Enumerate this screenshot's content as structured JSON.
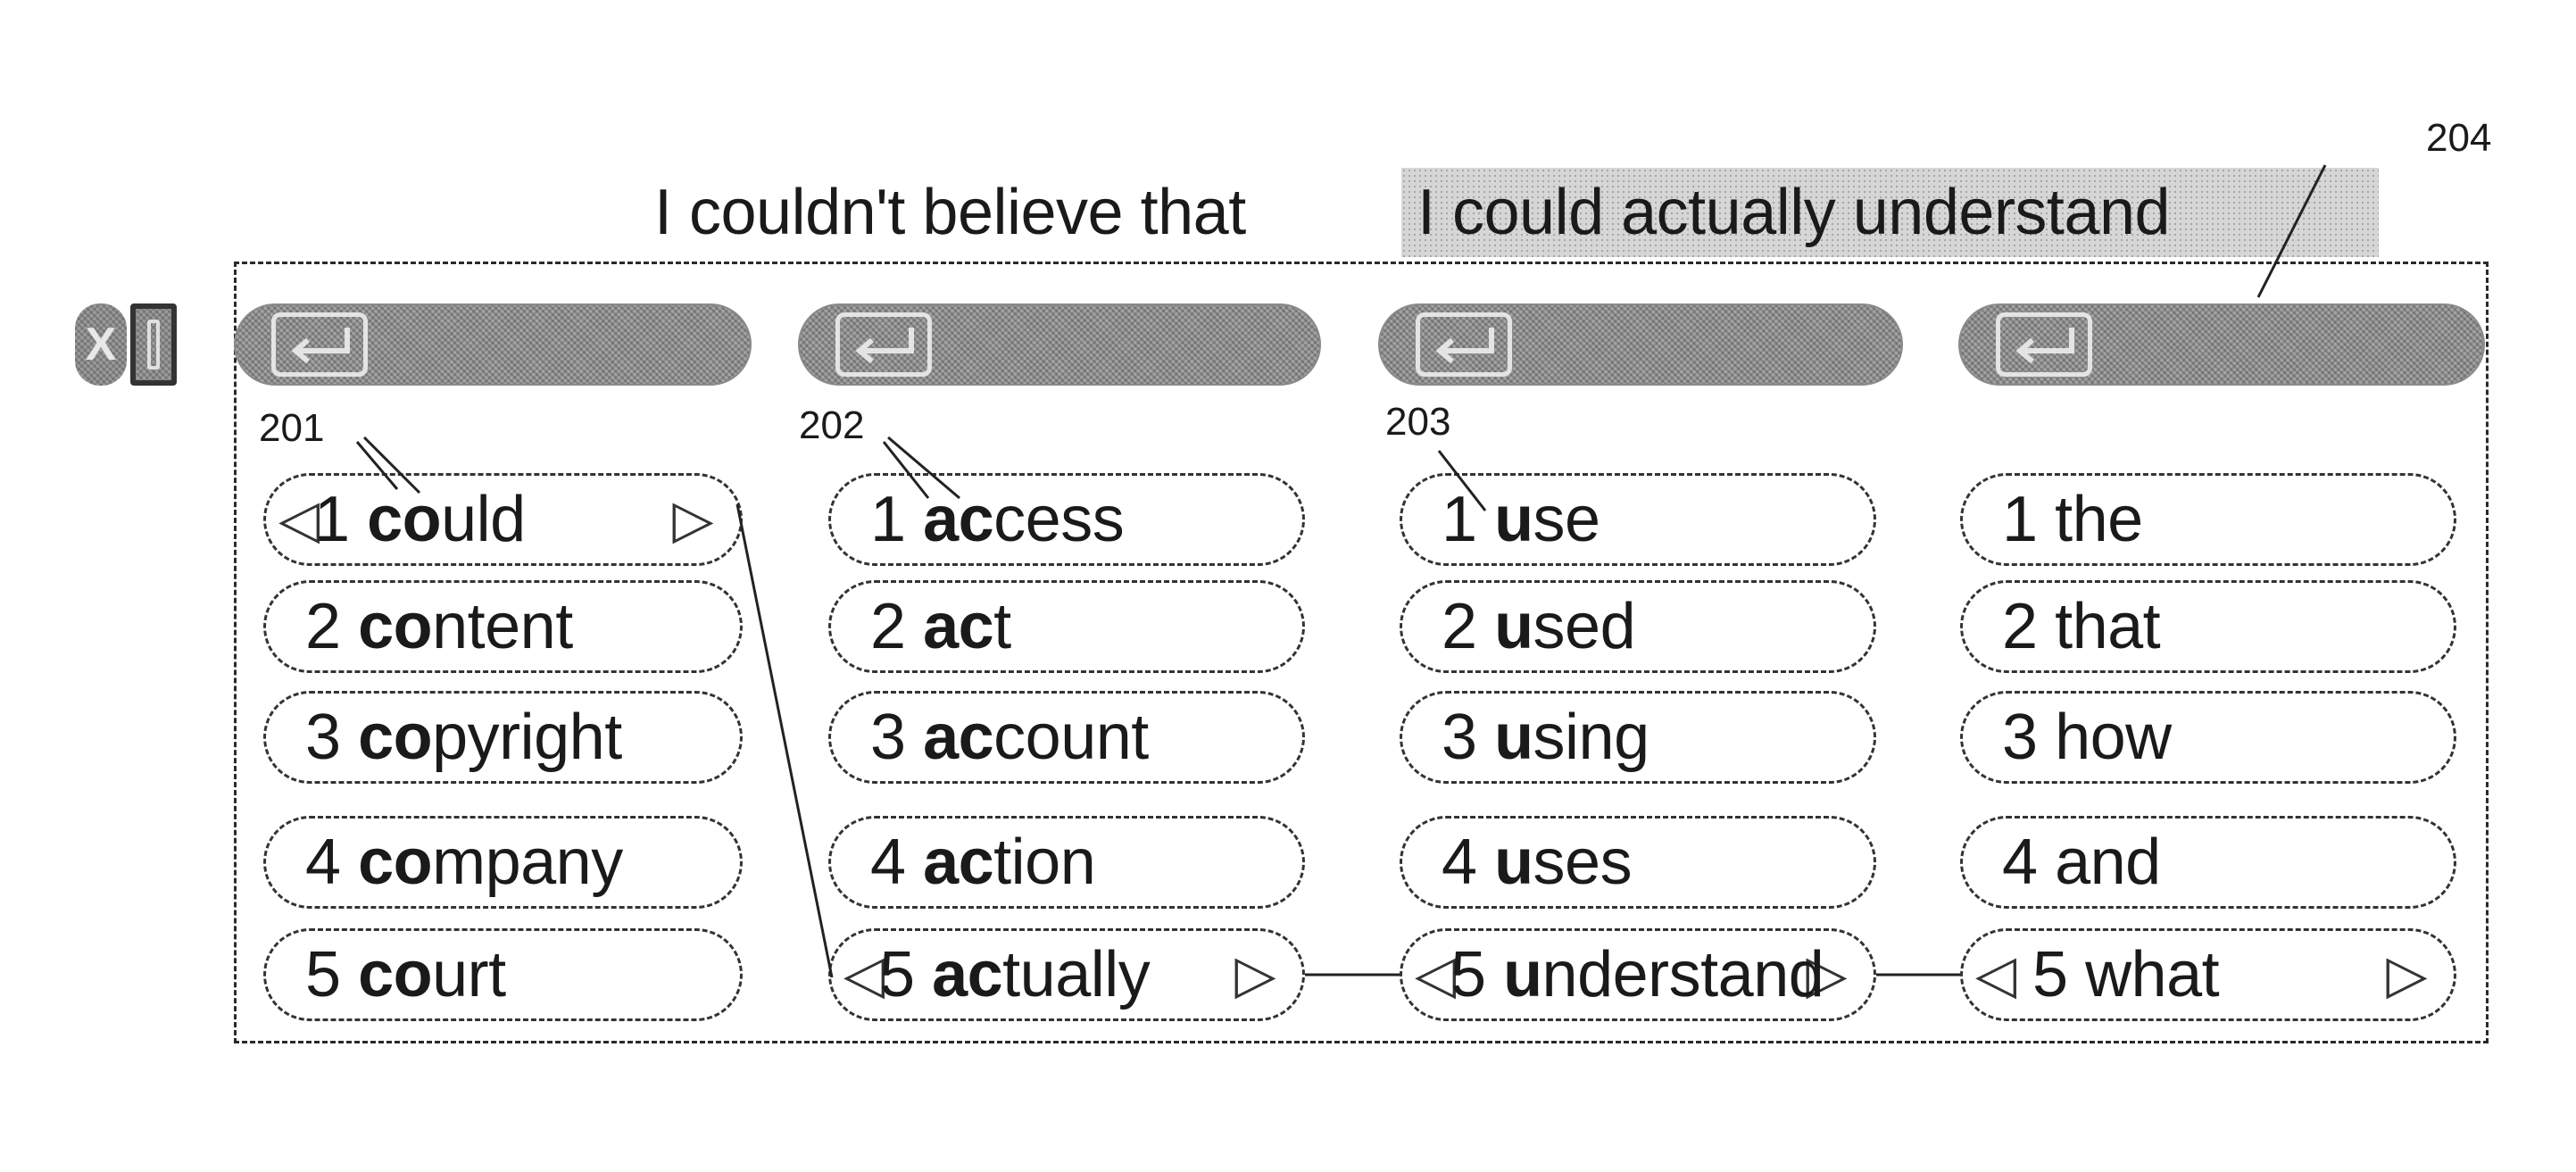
{
  "header": {
    "sentence_plain": "I couldn't believe that",
    "sentence_highlighted": "I could actually understand"
  },
  "controls": {
    "close_label": "X",
    "close_icon": "close-icon",
    "move_icon": "move-handle-icon"
  },
  "tabs": [
    {
      "icon": "enter-icon"
    },
    {
      "icon": "enter-icon"
    },
    {
      "icon": "enter-icon"
    },
    {
      "icon": "enter-icon"
    }
  ],
  "ref_labels": {
    "r201": "201",
    "r202": "202",
    "r203": "203",
    "r204": "204"
  },
  "columns": [
    {
      "prefix": "co",
      "candidates": [
        {
          "num": "1",
          "prefix": "co",
          "rest": "uld",
          "selected": true
        },
        {
          "num": "2",
          "prefix": "co",
          "rest": "ntent"
        },
        {
          "num": "3",
          "prefix": "co",
          "rest": "pyright"
        },
        {
          "num": "4",
          "prefix": "co",
          "rest": "mpany"
        },
        {
          "num": "5",
          "prefix": "co",
          "rest": "urt"
        }
      ]
    },
    {
      "prefix": "ac",
      "candidates": [
        {
          "num": "1",
          "prefix": "ac",
          "rest": "cess"
        },
        {
          "num": "2",
          "prefix": "ac",
          "rest": "t"
        },
        {
          "num": "3",
          "prefix": "ac",
          "rest": "count"
        },
        {
          "num": "4",
          "prefix": "ac",
          "rest": "tion"
        },
        {
          "num": "5",
          "prefix": "ac",
          "rest": "tually",
          "selected": true
        }
      ]
    },
    {
      "prefix": "u",
      "candidates": [
        {
          "num": "1",
          "prefix": "u",
          "rest": "se"
        },
        {
          "num": "2",
          "prefix": "u",
          "rest": "sed"
        },
        {
          "num": "3",
          "prefix": "u",
          "rest": "sing"
        },
        {
          "num": "4",
          "prefix": "u",
          "rest": "ses"
        },
        {
          "num": "5",
          "prefix": "u",
          "rest": "nderstand",
          "selected": true
        }
      ]
    },
    {
      "prefix": "",
      "candidates": [
        {
          "num": "1",
          "prefix": "",
          "rest": "the"
        },
        {
          "num": "2",
          "prefix": "",
          "rest": "that"
        },
        {
          "num": "3",
          "prefix": "",
          "rest": "how"
        },
        {
          "num": "4",
          "prefix": "",
          "rest": "and"
        },
        {
          "num": "5",
          "prefix": "",
          "rest": "what",
          "selected": true
        }
      ]
    }
  ],
  "arrows": {
    "left": "◁",
    "right": "▷"
  }
}
